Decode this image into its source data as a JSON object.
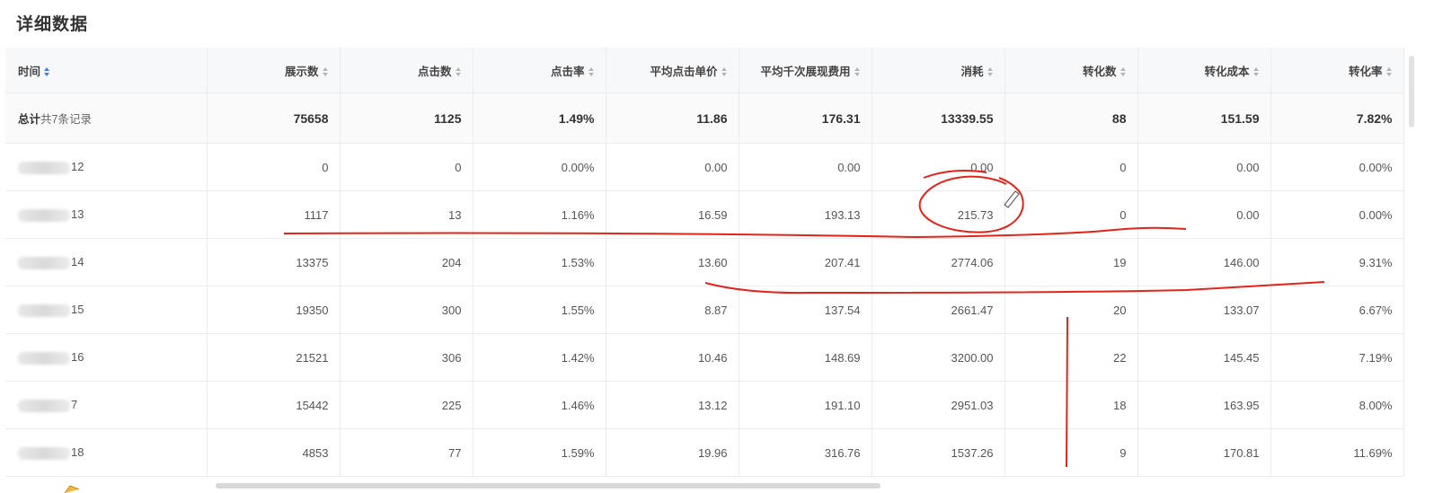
{
  "page": {
    "title": "详细数据"
  },
  "columns": [
    {
      "label": "时间",
      "sort_active": true
    },
    {
      "label": "展示数",
      "sort_active": false
    },
    {
      "label": "点击数",
      "sort_active": false
    },
    {
      "label": "点击率",
      "sort_active": false
    },
    {
      "label": "平均点击单价",
      "sort_active": false
    },
    {
      "label": "平均千次展现费用",
      "sort_active": false
    },
    {
      "label": "消耗",
      "sort_active": false
    },
    {
      "label": "转化数",
      "sort_active": false
    },
    {
      "label": "转化成本",
      "sort_active": false
    },
    {
      "label": "转化率",
      "sort_active": false
    }
  ],
  "total": {
    "label": "总计",
    "sublabel": "共7条记录",
    "values": [
      "75658",
      "1125",
      "1.49%",
      "11.86",
      "176.31",
      "13339.55",
      "88",
      "151.59",
      "7.82%"
    ]
  },
  "rows": [
    {
      "date": "12",
      "values": [
        "0",
        "0",
        "0.00%",
        "0.00",
        "0.00",
        "0.00",
        "0",
        "0.00",
        "0.00%"
      ]
    },
    {
      "date": "13",
      "values": [
        "1117",
        "13",
        "1.16%",
        "16.59",
        "193.13",
        "215.73",
        "0",
        "0.00",
        "0.00%"
      ]
    },
    {
      "date": "14",
      "values": [
        "13375",
        "204",
        "1.53%",
        "13.60",
        "207.41",
        "2774.06",
        "19",
        "146.00",
        "9.31%"
      ]
    },
    {
      "date": "15",
      "values": [
        "19350",
        "300",
        "1.55%",
        "8.87",
        "137.54",
        "2661.47",
        "20",
        "133.07",
        "6.67%"
      ]
    },
    {
      "date": "16",
      "values": [
        "21521",
        "306",
        "1.42%",
        "10.46",
        "148.69",
        "3200.00",
        "22",
        "145.45",
        "7.19%"
      ]
    },
    {
      "date": "7",
      "values": [
        "15442",
        "225",
        "1.46%",
        "13.12",
        "191.10",
        "2951.03",
        "18",
        "163.95",
        "8.00%"
      ]
    },
    {
      "date": "18",
      "values": [
        "4853",
        "77",
        "1.59%",
        "19.96",
        "316.76",
        "1537.26",
        "9",
        "170.81",
        "11.69%"
      ]
    }
  ],
  "colors": {
    "sort_active": "#3d7ff5",
    "sort_idle": "#b5b5b5",
    "annotation": "#e3241b"
  }
}
